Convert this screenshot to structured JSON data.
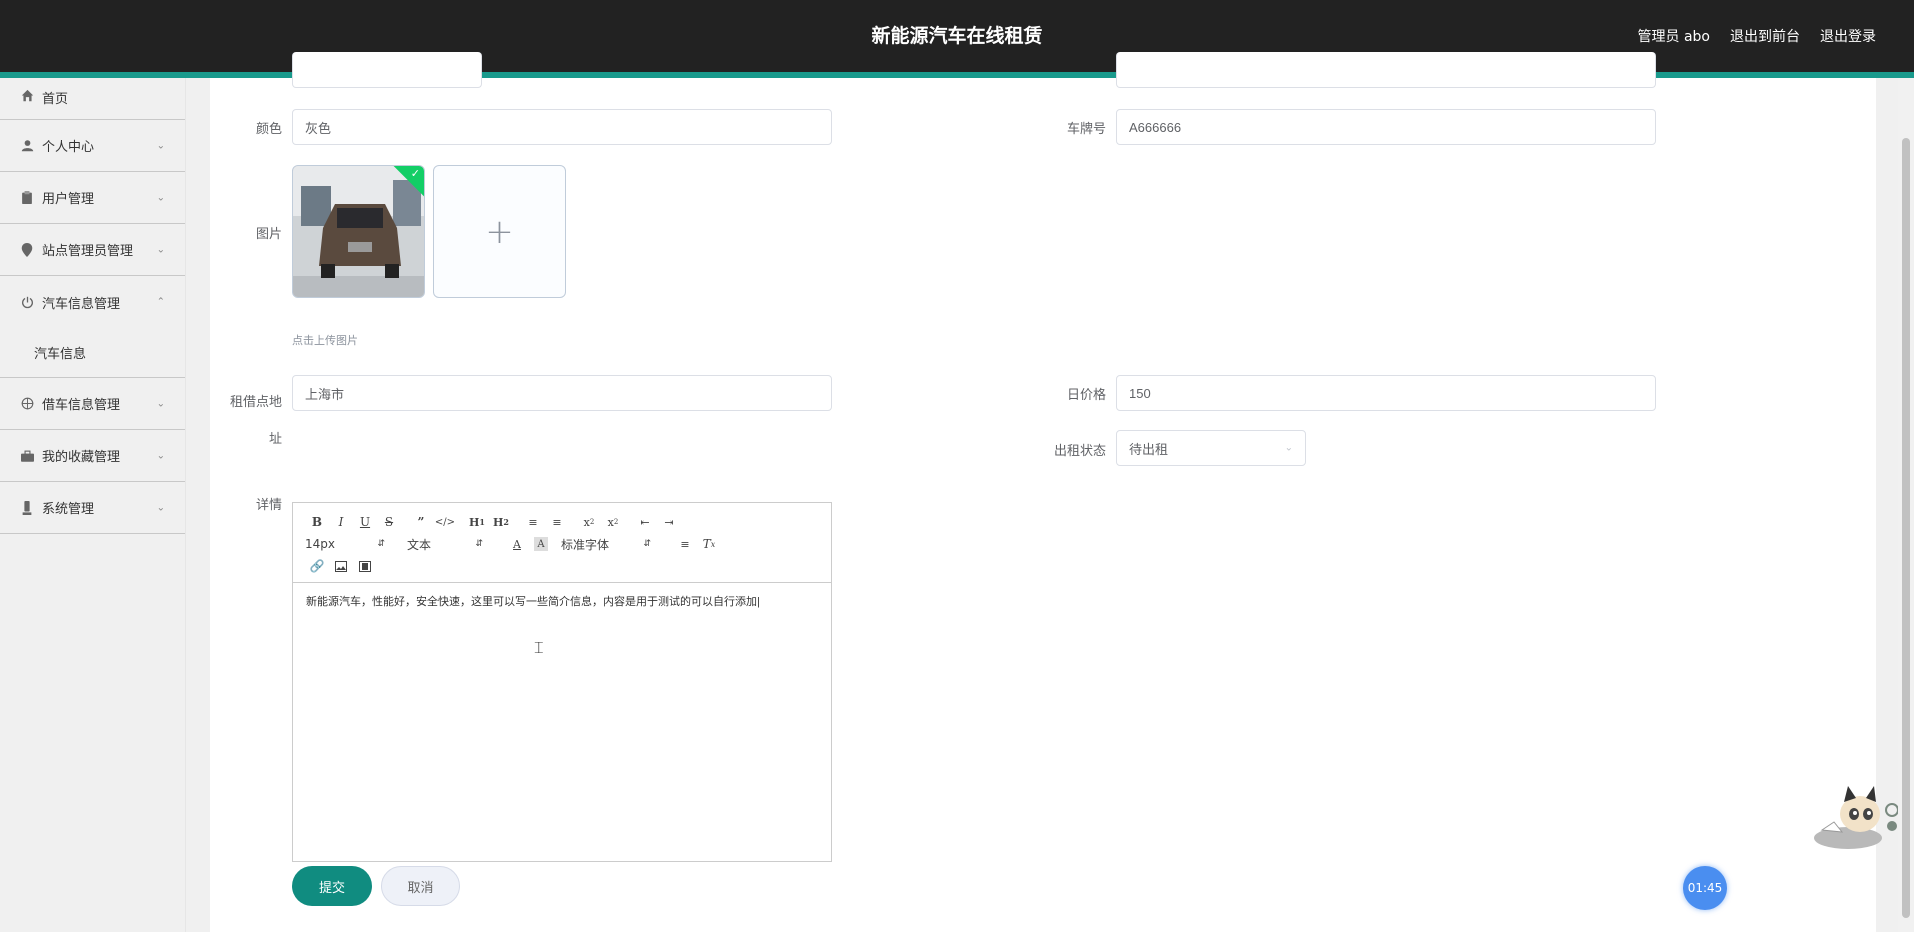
{
  "app": {
    "title": "新能源汽车在线租赁"
  },
  "topbar": {
    "admin_label": "管理员 abo",
    "to_front": "退出到前台",
    "logout": "退出登录"
  },
  "sidebar": {
    "items": [
      {
        "label": "首页",
        "icon": "home-icon"
      },
      {
        "label": "个人中心",
        "icon": "user-icon"
      },
      {
        "label": "用户管理",
        "icon": "clipboard-icon"
      },
      {
        "label": "站点管理员管理",
        "icon": "location-pin-icon"
      },
      {
        "label": "汽车信息管理",
        "icon": "power-icon",
        "expanded": true
      },
      {
        "label": "借车信息管理",
        "icon": "target-icon"
      },
      {
        "label": "我的收藏管理",
        "icon": "briefcase-icon"
      },
      {
        "label": "系统管理",
        "icon": "settings-icon"
      }
    ],
    "sub_item": "汽车信息"
  },
  "form": {
    "color_label": "颜色",
    "color_value": "灰色",
    "plate_label": "车牌号",
    "plate_value": "A666666",
    "image_label": "图片",
    "upload_hint": "点击上传图片",
    "address_label_1": "租借点地",
    "address_label_2": "址",
    "address_value": "上海市",
    "price_label": "日价格",
    "price_value": "150",
    "status_label": "出租状态",
    "status_value": "待出租",
    "detail_label": "详情"
  },
  "editor": {
    "size_select": "14px",
    "text_select": "文本",
    "font_select": "标准字体",
    "content": "新能源汽车，性能好，安全快速，这里可以写一些简介信息，内容是用于测试的可以自行添加"
  },
  "buttons": {
    "submit": "提交",
    "cancel": "取消"
  },
  "widget": {
    "timer": "01:45"
  },
  "colors": {
    "topbar": "#222222",
    "accent": "#199a8c",
    "submit": "#108c80"
  }
}
